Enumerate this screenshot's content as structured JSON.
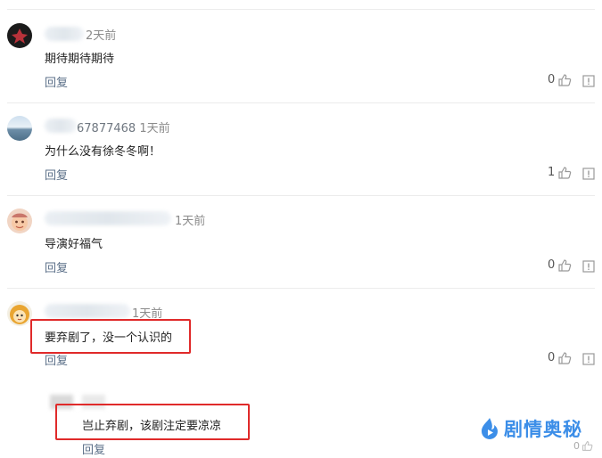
{
  "comments": [
    {
      "user_suffix": "",
      "time": "2天前",
      "text": "期待期待期待",
      "reply_label": "回复",
      "likes": "0"
    },
    {
      "user_suffix": "67877468",
      "time": "1天前",
      "text": "为什么没有徐冬冬啊！",
      "reply_label": "回复",
      "likes": "1"
    },
    {
      "user_suffix": "",
      "time": "1天前",
      "text": "导演好福气",
      "reply_label": "回复",
      "likes": "0"
    },
    {
      "user_suffix": "",
      "time": "1天前",
      "text": "要弃剧了，没一个认识的",
      "reply_label": "回复",
      "likes": "0"
    }
  ],
  "sub_reply": {
    "text": "岂止弃剧，该剧注定要凉凉",
    "reply_label": "回复",
    "likes": "0"
  },
  "watermark": {
    "text": "剧情奥秘"
  },
  "colors": {
    "highlight": "#e02a2a",
    "link": "#5b6f88",
    "watermark": "#3c8ee8"
  },
  "icons": {
    "like": "thumbs-up-icon",
    "report": "report-icon"
  }
}
